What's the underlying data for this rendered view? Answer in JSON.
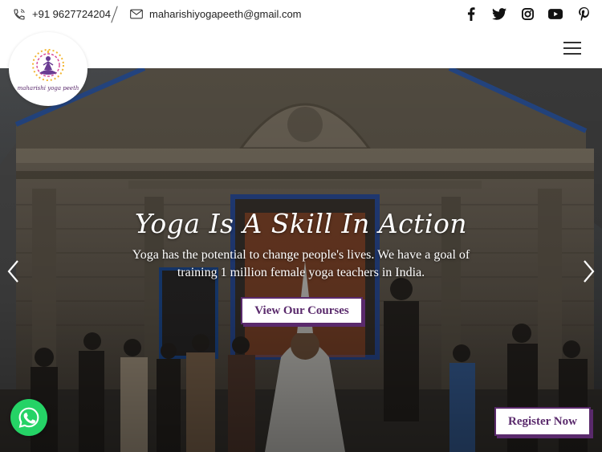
{
  "topbar": {
    "phone": "+91 9627724204",
    "email": "maharishiyogapeeth@gmail.com",
    "social_icons": [
      "facebook-icon",
      "twitter-icon",
      "instagram-icon",
      "youtube-icon",
      "pinterest-icon"
    ]
  },
  "logo": {
    "text": "maharishi yoga peeth"
  },
  "hero": {
    "title": "Yoga Is A Skill In Action",
    "text": "Yoga has the potential to change people's lives. We have a goal of training 1 million female yoga teachers in India.",
    "cta_label": "View Our Courses"
  },
  "register_label": "Register Now",
  "colors": {
    "brand": "#5a2a6c",
    "whatsapp": "#25d366"
  }
}
